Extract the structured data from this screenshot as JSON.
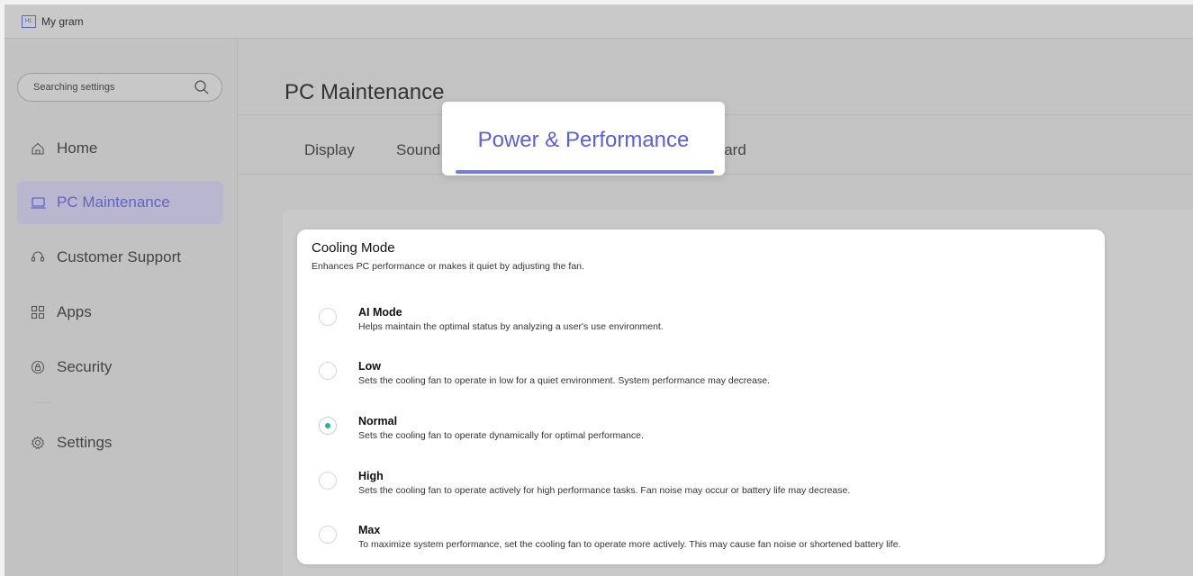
{
  "app": {
    "logo_text": "HL",
    "title": "My gram"
  },
  "search": {
    "placeholder": "Searching settings"
  },
  "sidebar": {
    "items": [
      {
        "label": "Home",
        "icon": "home-icon"
      },
      {
        "label": "PC Maintenance",
        "icon": "laptop-icon",
        "active": true
      },
      {
        "label": "Customer Support",
        "icon": "headset-icon"
      },
      {
        "label": "Apps",
        "icon": "apps-grid-icon"
      },
      {
        "label": "Security",
        "icon": "shield-icon"
      },
      {
        "label": "Settings",
        "icon": "gear-icon"
      }
    ]
  },
  "main": {
    "title": "PC Maintenance",
    "tabs": [
      {
        "label": "Display"
      },
      {
        "label": "Sound"
      },
      {
        "label": "Power & Performance",
        "active": true
      },
      {
        "label": "Keyboard"
      }
    ]
  },
  "cooling": {
    "title": "Cooling Mode",
    "description": "Enhances PC performance or makes it quiet by adjusting the fan.",
    "selected": "Normal",
    "options": [
      {
        "label": "AI Mode",
        "description": "Helps maintain the optimal status by analyzing a user's use environment."
      },
      {
        "label": "Low",
        "description": "Sets the cooling fan to operate in low for a quiet environment. System performance may decrease."
      },
      {
        "label": "Normal",
        "description": "Sets the cooling fan to operate dynamically for optimal performance."
      },
      {
        "label": "High",
        "description": "Sets the cooling fan to operate actively for high performance tasks. Fan noise may occur or battery life may decrease."
      },
      {
        "label": "Max",
        "description": "To maximize system performance, set the cooling fan to operate more actively. This may cause fan noise or shortened battery life."
      }
    ]
  },
  "colors": {
    "accent": "#5b60d6",
    "radio_selected": "#1fb59a",
    "overlay": "#c3c3c3"
  }
}
